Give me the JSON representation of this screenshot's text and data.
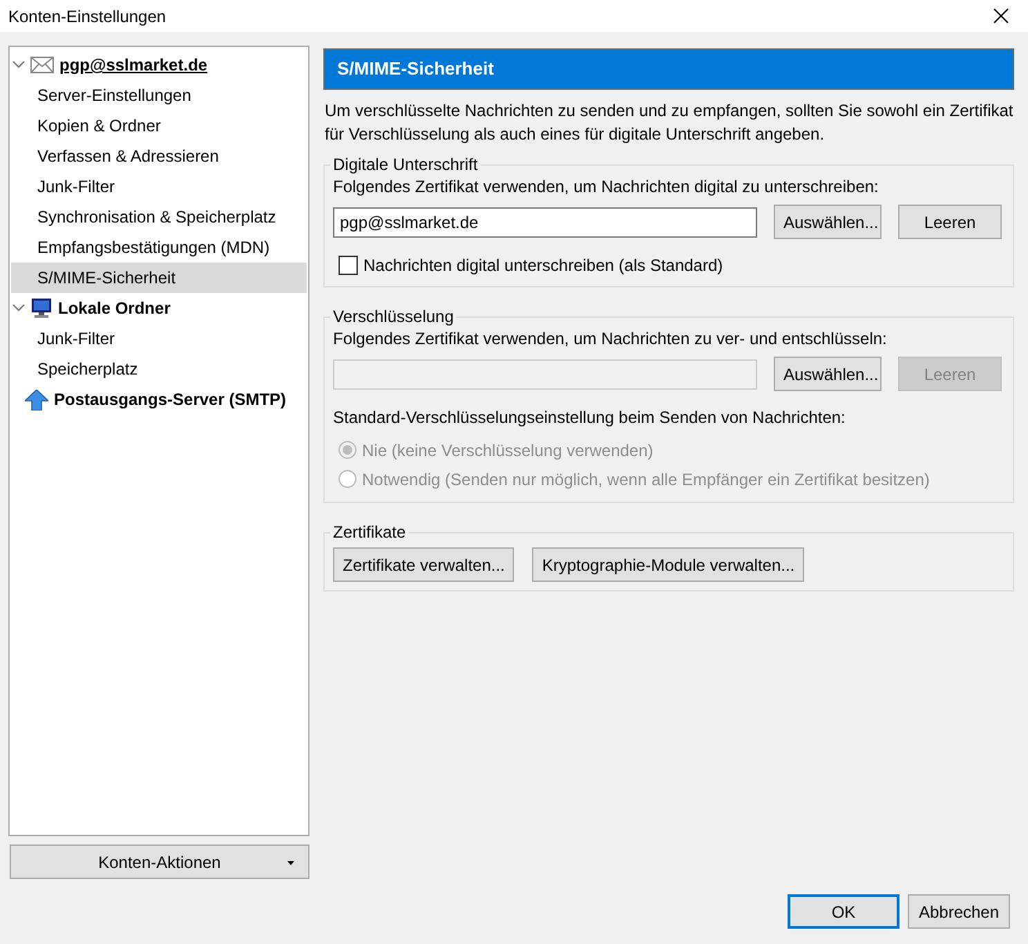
{
  "window": {
    "title": "Konten-Einstellungen"
  },
  "sidebar": {
    "accounts": [
      {
        "kind": "mail",
        "name": "pgp@sslmarket.de",
        "expanded": true,
        "children": [
          {
            "label": "Server-Einstellungen",
            "selected": false
          },
          {
            "label": "Kopien & Ordner",
            "selected": false
          },
          {
            "label": "Verfassen & Adressieren",
            "selected": false
          },
          {
            "label": "Junk-Filter",
            "selected": false
          },
          {
            "label": "Synchronisation & Speicherplatz",
            "selected": false
          },
          {
            "label": "Empfangsbestätigungen (MDN)",
            "selected": false
          },
          {
            "label": "S/MIME-Sicherheit",
            "selected": true
          }
        ]
      },
      {
        "kind": "local",
        "name": "Lokale Ordner",
        "expanded": true,
        "children": [
          {
            "label": "Junk-Filter",
            "selected": false
          },
          {
            "label": "Speicherplatz",
            "selected": false
          }
        ]
      },
      {
        "kind": "smtp",
        "name": "Postausgangs-Server (SMTP)"
      }
    ]
  },
  "account_actions_button": "Konten-Aktionen",
  "panel": {
    "title": "S/MIME-Sicherheit",
    "description": "Um verschlüsselte Nachrichten zu senden und zu empfangen, sollten Sie sowohl ein Zertifikat für Verschlüsselung als auch eines für digitale Unterschrift angeben.",
    "signing": {
      "legend": "Digitale Unterschrift",
      "label": "Folgendes Zertifikat verwenden, um Nachrichten digital zu unterschreiben:",
      "certificate": "pgp@sslmarket.de",
      "field_disabled": false,
      "buttons": [
        {
          "label": "Auswählen...",
          "disabled": false
        },
        {
          "label": "Leeren",
          "disabled": false
        }
      ],
      "checkbox": {
        "label": "Nachrichten digital unterschreiben (als Standard)",
        "checked": false
      }
    },
    "encryption": {
      "legend": "Verschlüsselung",
      "label": "Folgendes Zertifikat verwenden, um Nachrichten zu ver- und entschlüsseln:",
      "field_disabled": true,
      "buttons": [
        {
          "label": "Auswählen...",
          "disabled": false
        },
        {
          "label": "Leeren",
          "disabled": true
        }
      ],
      "policy_label": "Standard-Verschlüsselungseinstellung beim Senden von Nachrichten:",
      "options": [
        {
          "label": "Nie (keine Verschlüsselung verwenden)",
          "selected": true,
          "disabled": true
        },
        {
          "label": "Notwendig (Senden nur möglich, wenn alle Empfänger ein Zertifikat besitzen)",
          "selected": false,
          "disabled": true
        }
      ]
    },
    "certificates": {
      "legend": "Zertifikate",
      "buttons": [
        "Zertifikate verwalten...",
        "Kryptographie-Module verwalten..."
      ]
    }
  },
  "dialog_buttons": [
    {
      "label": "OK",
      "default": true
    },
    {
      "label": "Abbrechen",
      "default": false
    }
  ]
}
